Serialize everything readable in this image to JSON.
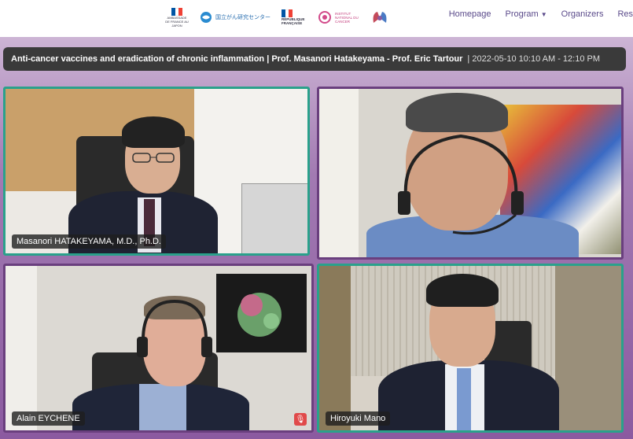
{
  "nav": {
    "items": [
      {
        "label": "Homepage"
      },
      {
        "label": "Program",
        "has_dropdown": true
      },
      {
        "label": "Organizers"
      },
      {
        "label": "Res"
      }
    ]
  },
  "logos": [
    {
      "name": "ambassade-de-france-au-japon-logo",
      "text": "AMBASSADE DE FRANCE AU JAPON"
    },
    {
      "name": "national-cancer-center-japan-logo",
      "text": "国立がん研究センター"
    },
    {
      "name": "republique-francaise-logo",
      "text": "RÉPUBLIQUE FRANÇAISE"
    },
    {
      "name": "institut-national-du-cancer-logo",
      "text": "INSTITUT NATIONAL DU CANCER"
    },
    {
      "name": "society-logo",
      "text": ""
    }
  ],
  "session": {
    "title": "Anti-cancer vaccines and eradication of chronic inflammation | Prof. Masanori Hatakeyama - Prof. Eric Tartour",
    "datetime": "| 2022-05-10 10:10 AM - 12:10 PM"
  },
  "participants": [
    {
      "name": "Masanori HATAKEYAMA, M.D., Ph.D.",
      "active": true,
      "muted": false
    },
    {
      "name": "",
      "active": false,
      "muted": false
    },
    {
      "name": "Alain EYCHENE",
      "active": false,
      "muted": true
    },
    {
      "name": "Hiroyuki Mano",
      "active": true,
      "muted": false
    }
  ],
  "colors": {
    "active_border": "#2aa18b",
    "title_bg": "#3a3a3a",
    "nav_text": "#5a4a8a",
    "muted_badge": "#e04a4a"
  }
}
